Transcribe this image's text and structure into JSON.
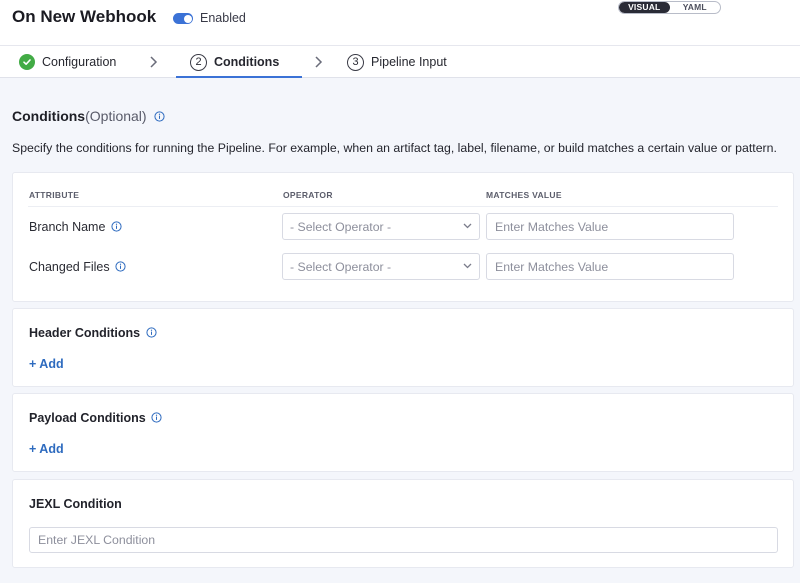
{
  "header": {
    "title": "On New Webhook",
    "toggle_label": "Enabled",
    "view_options": [
      "VISUAL",
      "YAML"
    ],
    "active_view": "VISUAL"
  },
  "steps": [
    {
      "label": "Configuration",
      "status": "complete",
      "icon": "check-icon"
    },
    {
      "number": "2",
      "label": "Conditions",
      "status": "active"
    },
    {
      "number": "3",
      "label": "Pipeline Input",
      "status": "pending"
    }
  ],
  "main": {
    "title": "Conditions",
    "title_suffix": "(Optional)",
    "description": "Specify the conditions for running the Pipeline. For example, when an artifact tag, label, filename, or build matches a certain value or pattern."
  },
  "conditions_table": {
    "headers": [
      "ATTRIBUTE",
      "OPERATOR",
      "MATCHES VALUE"
    ],
    "rows": [
      {
        "attribute": "Branch Name",
        "operator_placeholder": "- Select Operator -",
        "value_placeholder": "Enter Matches Value"
      },
      {
        "attribute": "Changed Files",
        "operator_placeholder": "- Select Operator -",
        "value_placeholder": "Enter Matches Value"
      }
    ]
  },
  "header_conditions": {
    "title": "Header Conditions",
    "add_label": "+ Add"
  },
  "payload_conditions": {
    "title": "Payload Conditions",
    "add_label": "+ Add"
  },
  "jexl": {
    "title": "JEXL Condition",
    "placeholder": "Enter JEXL Condition"
  },
  "colors": {
    "accent": "#3b72d6",
    "link": "#2e6bbf",
    "success": "#42ab45"
  }
}
